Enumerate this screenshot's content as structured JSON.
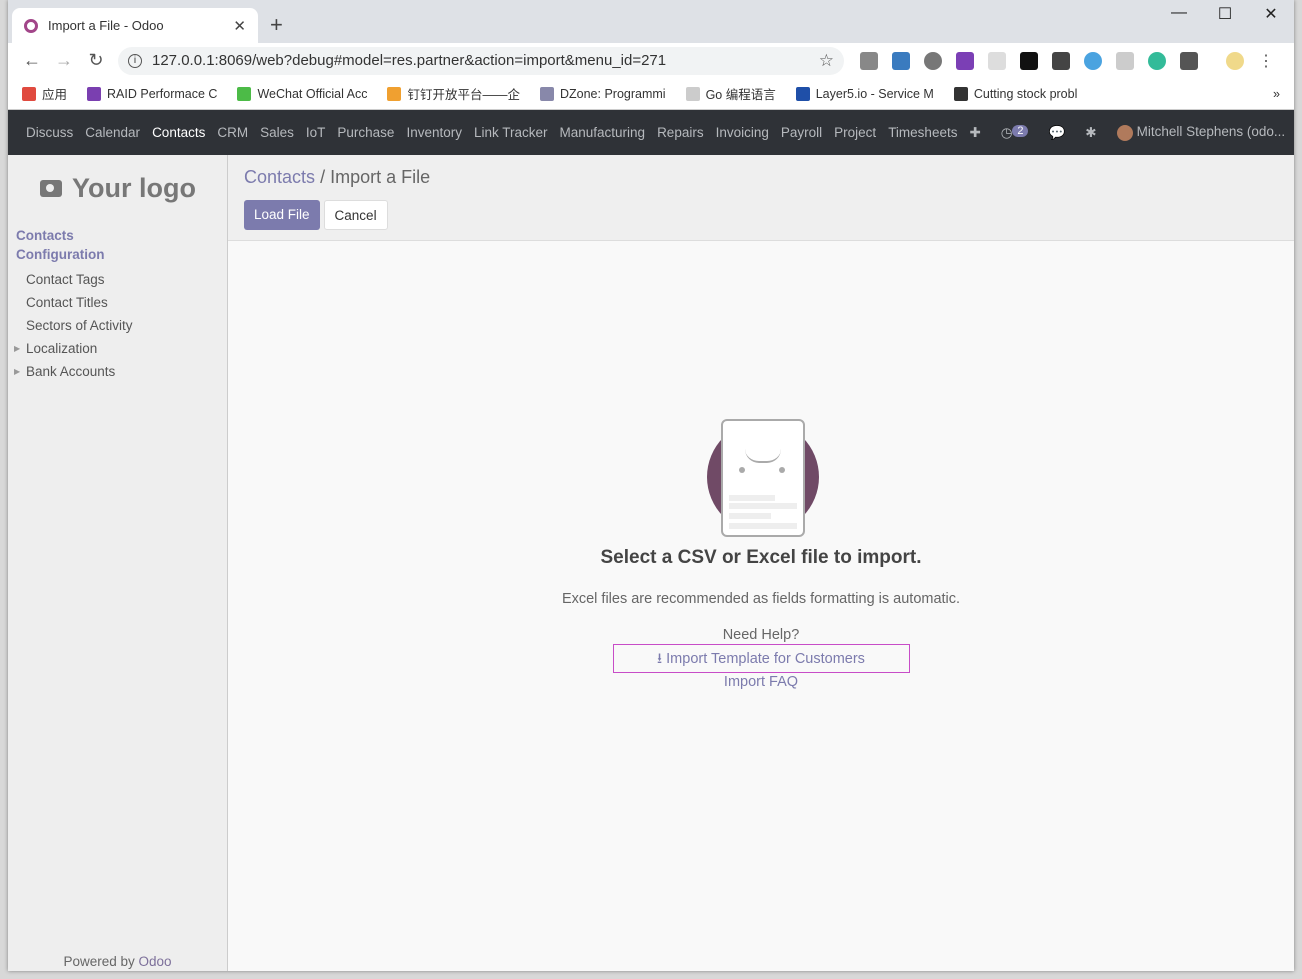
{
  "browser": {
    "tab_title": "Import a File - Odoo",
    "url": "127.0.0.1:8069/web?debug#model=res.partner&action=import&menu_id=271",
    "bookmarks": [
      {
        "label": "应用",
        "color": "#e04a3f"
      },
      {
        "label": "RAID Performace C",
        "color": "#7a3fb0"
      },
      {
        "label": "WeChat Official Acc",
        "color": "#4cbb47"
      },
      {
        "label": "钉钉开放平台——企",
        "color": "#f0a030"
      },
      {
        "label": "DZone: Programmi",
        "color": "#88a"
      },
      {
        "label": "Go 编程语言",
        "color": "#ccc"
      },
      {
        "label": "Layer5.io - Service M",
        "color": "#1f4fa8"
      },
      {
        "label": "Cutting stock probl",
        "color": "#333"
      }
    ],
    "more": "»"
  },
  "navbar": {
    "menus": [
      "Discuss",
      "Calendar",
      "Contacts",
      "CRM",
      "Sales",
      "IoT",
      "Purchase",
      "Inventory",
      "Link Tracker",
      "Manufacturing",
      "Repairs",
      "Invoicing",
      "Payroll",
      "Project",
      "Timesheets"
    ],
    "active": "Contacts",
    "plus": "✚",
    "activity_count": "2",
    "user": "Mitchell Stephens (odo..."
  },
  "sidebar": {
    "logo": "Your logo",
    "sections": [
      "Contacts",
      "Configuration"
    ],
    "items": [
      {
        "label": "Contact Tags"
      },
      {
        "label": "Contact Titles"
      },
      {
        "label": "Sectors of Activity"
      },
      {
        "label": "Localization",
        "expandable": true
      },
      {
        "label": "Bank Accounts",
        "expandable": true
      }
    ],
    "powered_by": "Powered by",
    "brand": "Odoo"
  },
  "control_panel": {
    "breadcrumb_parent": "Contacts",
    "breadcrumb_sep": "/",
    "breadcrumb_current": "Import a File",
    "load_file": "Load File",
    "cancel": "Cancel"
  },
  "content": {
    "title": "Select a CSV or Excel file to import.",
    "subtitle": "Excel files are recommended as fields formatting is automatic.",
    "need_help": "Need Help?",
    "template_link": "Import Template for Customers",
    "faq_link": "Import FAQ"
  },
  "colors": {
    "accent": "#7c7bad",
    "navbar": "#2f3237",
    "illustration": "#704a66"
  }
}
